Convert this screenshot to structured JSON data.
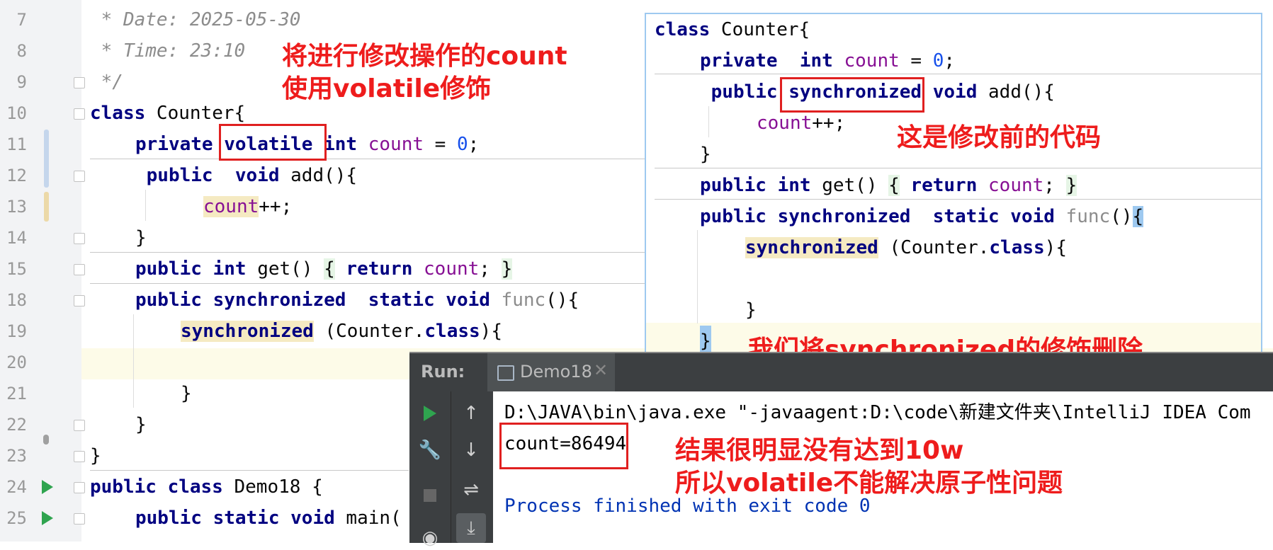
{
  "editor": {
    "line_numbers": [
      "7",
      "8",
      "9",
      "10",
      "11",
      "12",
      "13",
      "14",
      "15",
      "18",
      "19",
      "20",
      "21",
      "22",
      "23",
      "24",
      "25"
    ],
    "date_comment": " * Date: 2025-05-30",
    "time_comment": " * Time: 23:10",
    "end_comment": " */",
    "lines": {
      "l10_a": "class",
      "l10_b": " Counter{",
      "l11_a": "private ",
      "l11_b": "volatile",
      "l11_c": " int ",
      "l11_d": "count",
      "l11_e": " = ",
      "l11_f": "0",
      "l11_g": ";",
      "l12_a": " public  void",
      "l12_b": " add(){",
      "l13_a": "count",
      "l13_b": "++;",
      "l14": "}",
      "l15_a": "public int",
      "l15_b": " get() ",
      "l15_c": "{",
      "l15_d": " return ",
      "l15_e": "count",
      "l15_f": "; ",
      "l15_g": "}",
      "l18_a": "public synchronized  static void",
      "l18_b": " func",
      "l18_c": "(){",
      "l19_a": "synchronized",
      "l19_b": " (Counter.",
      "l19_c": "class",
      "l19_d": "){",
      "l21": "}",
      "l22": "}",
      "l23": "}",
      "l24_a": "public class",
      "l24_b": " Demo18 {",
      "l25_a": "public static void",
      "l25_b": " main("
    }
  },
  "annotations": {
    "top_left": "将进行修改操作的count\n使用volatile修饰",
    "overlay_mid": "这是修改前的代码",
    "overlay_bottom": "我们将synchronized的修饰删除",
    "result": "结果很明显没有达到10w\n所以volatile不能解决原子性问题"
  },
  "overlay": {
    "o1_a": "class",
    "o1_b": " Counter{",
    "o2_a": "private  int ",
    "o2_b": "count",
    "o2_c": " = ",
    "o2_d": "0",
    "o2_e": ";",
    "o3_a": " public ",
    "o3_b": "synchronized",
    "o3_c": " void",
    "o3_d": " add(){",
    "o4_a": "count",
    "o4_b": "++;",
    "o5": "}",
    "o6_a": "public int",
    "o6_b": " get() ",
    "o6_c": "{",
    "o6_d": " return ",
    "o6_e": "count",
    "o6_f": "; ",
    "o6_g": "}",
    "o7_a": "public synchronized  static void",
    "o7_b": " func",
    "o7_c": "()",
    "o7_d": "{",
    "o8_a": "synchronized",
    "o8_b": " (Counter.",
    "o8_c": "class",
    "o8_d": "){",
    "o9": "}",
    "o10": "}",
    "o11": "}"
  },
  "run_panel": {
    "label": "Run:",
    "tab": "Demo18",
    "cmd_line": "D:\\JAVA\\bin\\java.exe \"-javaagent:D:\\code\\新建文件夹\\IntelliJ IDEA Com",
    "result_line": "count=86494",
    "exit_line": "Process finished with exit code 0"
  },
  "colors": {
    "accent_red": "#ee1c1c",
    "run_green": "#2fa44f"
  }
}
